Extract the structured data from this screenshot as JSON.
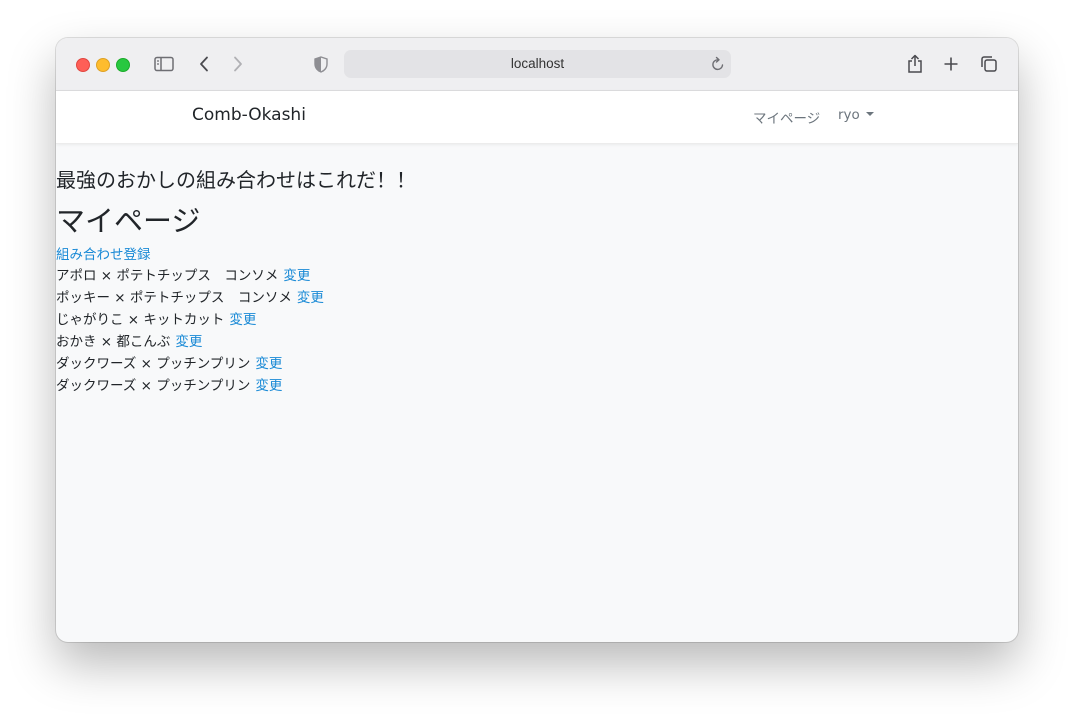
{
  "browser": {
    "url": "localhost",
    "colors": {
      "close": "#fe5f57",
      "minimize": "#febc2e",
      "zoom": "#28c840"
    },
    "icons": [
      "sidebar-icon",
      "back-chevron-icon",
      "forward-chevron-icon",
      "privacy-shield-icon",
      "reload-icon",
      "share-icon",
      "new-tab-plus-icon",
      "tabs-overview-icon"
    ]
  },
  "navbar": {
    "brand": "Comb-Okashi",
    "mypage_link": "マイページ",
    "user_menu": "ryo"
  },
  "main": {
    "tagline": "最強のおかしの組み合わせはこれだ！！",
    "title": "マイページ",
    "register_link": "組み合わせ登録",
    "combinations": [
      {
        "text": "アポロ × ポテトチップス　コンソメ",
        "action": "変更"
      },
      {
        "text": "ポッキー × ポテトチップス　コンソメ",
        "action": "変更"
      },
      {
        "text": "じゃがりこ × キットカット",
        "action": "変更"
      },
      {
        "text": "おかき × 都こんぶ",
        "action": "変更"
      },
      {
        "text": "ダックワーズ × プッチンプリン",
        "action": "変更"
      },
      {
        "text": "ダックワーズ × プッチンプリン",
        "action": "変更"
      }
    ],
    "link_color": "#1a8ad6"
  }
}
